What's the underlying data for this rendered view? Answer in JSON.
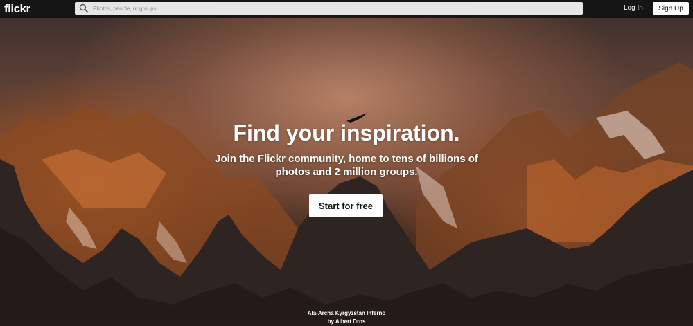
{
  "header": {
    "logo_text": "flickr",
    "search_placeholder": "Photos, people, or groups",
    "login_label": "Log In",
    "signup_label": "Sign Up"
  },
  "hero": {
    "headline": "Find your inspiration.",
    "subheading": "Join the Flickr community, home to tens of billions of photos and 2 million groups.",
    "cta_label": "Start for free"
  },
  "photo_credit": {
    "title": "Ala-Archa Kyrgyzstan Inferno",
    "author": "by Albert Dros"
  },
  "icons": {
    "search": "search-icon"
  },
  "colors": {
    "topbar": "#121212",
    "button_bg": "#ffffff",
    "text": "#ffffff"
  }
}
